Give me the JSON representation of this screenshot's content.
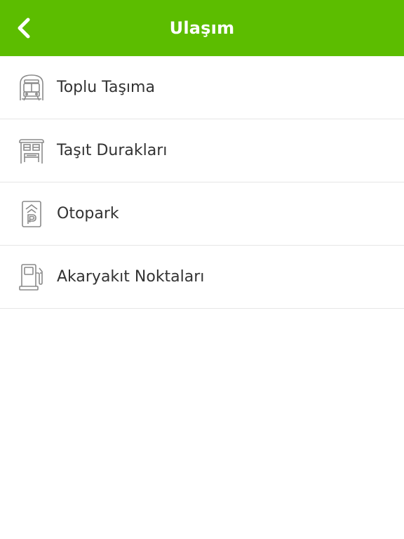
{
  "header": {
    "title": "Ulaşım",
    "back_icon": "chevron-left-icon",
    "background_color": "#5cbd00",
    "text_color": "#ffffff"
  },
  "menu": {
    "items": [
      {
        "label": "Toplu Taşıma",
        "icon": "train-icon"
      },
      {
        "label": "Taşıt Durakları",
        "icon": "bus-stop-icon"
      },
      {
        "label": "Otopark",
        "icon": "parking-icon"
      },
      {
        "label": "Akaryakıt Noktaları",
        "icon": "fuel-pump-icon"
      }
    ]
  }
}
